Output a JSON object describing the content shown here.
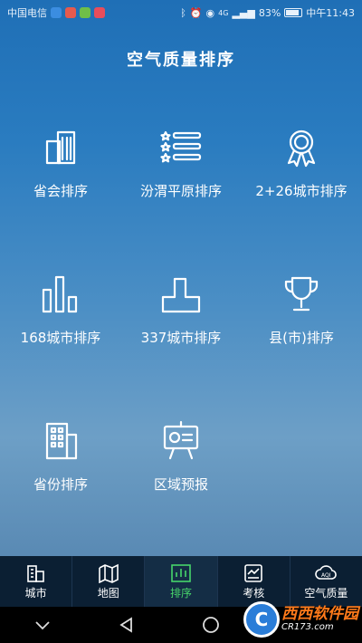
{
  "status": {
    "carrier": "中国电信",
    "network": "4G",
    "battery": "83%",
    "battery_level": 0.83,
    "time": "中午11:43"
  },
  "title": "空气质量排序",
  "items": [
    {
      "label": "省会排序",
      "icon": "buildings-icon"
    },
    {
      "label": "汾渭平原排序",
      "icon": "star-list-icon"
    },
    {
      "label": "2+26城市排序",
      "icon": "award-medal-icon"
    },
    {
      "label": "168城市排序",
      "icon": "bar-chart-icon"
    },
    {
      "label": "337城市排序",
      "icon": "podium-icon"
    },
    {
      "label": "县(市)排序",
      "icon": "trophy-icon"
    },
    {
      "label": "省份排序",
      "icon": "building-icon"
    },
    {
      "label": "区域预报",
      "icon": "presentation-board-icon"
    }
  ],
  "tabs": [
    {
      "label": "城市",
      "icon": "city-icon"
    },
    {
      "label": "地图",
      "icon": "map-icon"
    },
    {
      "label": "排序",
      "icon": "ranking-icon",
      "active": true
    },
    {
      "label": "考核",
      "icon": "assessment-icon"
    },
    {
      "label": "空气质量",
      "icon": "aqi-icon"
    }
  ],
  "watermark": {
    "main": "西西软件园",
    "sub": "CR173.com"
  },
  "colors": {
    "active_tab": "#47d56b",
    "tabbar_bg": "#0b1f33",
    "background_top": "#1f6fb6"
  }
}
